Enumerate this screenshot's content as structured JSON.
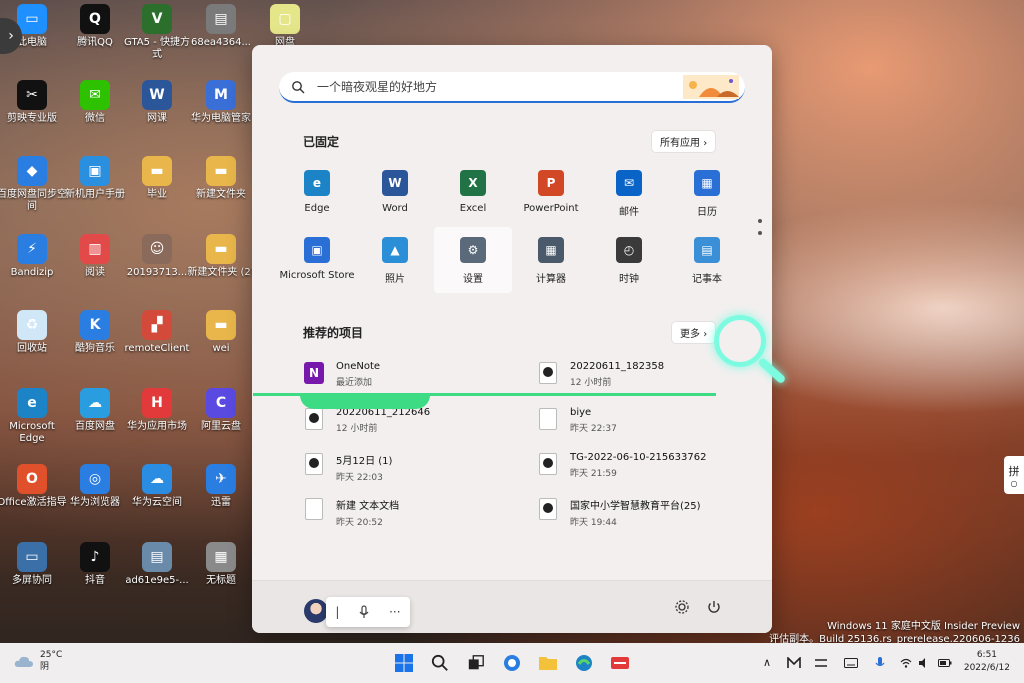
{
  "desktop": {
    "icons": [
      {
        "label": "此电脑",
        "color": "#1e90ff",
        "glyph": "▭"
      },
      {
        "label": "腾讯QQ",
        "color": "#111111",
        "glyph": "Q"
      },
      {
        "label": "GTA5 - 快捷方式",
        "color": "#2c6e2c",
        "glyph": "V"
      },
      {
        "label": "68ea4364...",
        "color": "#7a7a7a",
        "glyph": "▤"
      },
      {
        "label": "网盘",
        "color": "#e5e58a",
        "glyph": "▢"
      },
      {
        "label": "剪映专业版",
        "color": "#111111",
        "glyph": "✂"
      },
      {
        "label": "微信",
        "color": "#2dc100",
        "glyph": "✉"
      },
      {
        "label": "网课",
        "color": "#2b579a",
        "glyph": "W"
      },
      {
        "label": "华为电脑管家",
        "color": "#3a6fd8",
        "glyph": "M"
      },
      {
        "label": "百度网盘同步空间",
        "color": "#2a7de1",
        "glyph": "◆"
      },
      {
        "label": "新机用户手册",
        "color": "#2b8fe0",
        "glyph": "▣"
      },
      {
        "label": "毕业",
        "color": "#e8b64a",
        "glyph": "▬"
      },
      {
        "label": "新建文件夹",
        "color": "#e8b64a",
        "glyph": "▬"
      },
      {
        "label": "Bandizip",
        "color": "#2a7de1",
        "glyph": "⚡"
      },
      {
        "label": "阅读",
        "color": "#e24a4a",
        "glyph": "▥"
      },
      {
        "label": "20193713...",
        "color": "#8a6a5a",
        "glyph": "☺"
      },
      {
        "label": "新建文件夹 (2)",
        "color": "#e8b64a",
        "glyph": "▬"
      },
      {
        "label": "回收站",
        "color": "#cfe7f6",
        "glyph": "♻"
      },
      {
        "label": "酷狗音乐",
        "color": "#2a7de1",
        "glyph": "K"
      },
      {
        "label": "remoteClient",
        "color": "#d44a3a",
        "glyph": "▞"
      },
      {
        "label": "wei",
        "color": "#e8b64a",
        "glyph": "▬"
      },
      {
        "label": "Microsoft Edge",
        "color": "#1c84c6",
        "glyph": "e"
      },
      {
        "label": "百度网盘",
        "color": "#2a9de1",
        "glyph": "☁"
      },
      {
        "label": "华为应用市场",
        "color": "#e23a3a",
        "glyph": "H"
      },
      {
        "label": "阿里云盘",
        "color": "#5a4ae2",
        "glyph": "C"
      },
      {
        "label": "Office激活指导",
        "color": "#e0502a",
        "glyph": "O"
      },
      {
        "label": "华为浏览器",
        "color": "#2a7de1",
        "glyph": "◎"
      },
      {
        "label": "华为云空间",
        "color": "#2a8de1",
        "glyph": "☁"
      },
      {
        "label": "迅雷",
        "color": "#2a7de1",
        "glyph": "✈"
      },
      {
        "label": "多屏协同",
        "color": "#3a6fa8",
        "glyph": "▭"
      },
      {
        "label": "抖音",
        "color": "#111111",
        "glyph": "♪"
      },
      {
        "label": "ad61e9e5-...",
        "color": "#6a8aaa",
        "glyph": "▤"
      },
      {
        "label": "无标题",
        "color": "#8a8a8a",
        "glyph": "▦"
      }
    ]
  },
  "start_menu": {
    "search_placeholder": "一个暗夜观星的好地方",
    "pinned_title": "已固定",
    "all_apps_label": "所有应用",
    "pinned_apps": [
      {
        "label": "Edge",
        "color": "#1c84c6",
        "glyph": "e"
      },
      {
        "label": "Word",
        "color": "#2b579a",
        "glyph": "W"
      },
      {
        "label": "Excel",
        "color": "#217346",
        "glyph": "X"
      },
      {
        "label": "PowerPoint",
        "color": "#d24726",
        "glyph": "P"
      },
      {
        "label": "邮件",
        "color": "#0a64c8",
        "glyph": "✉"
      },
      {
        "label": "日历",
        "color": "#2a6fd6",
        "glyph": "▦"
      },
      {
        "label": "Microsoft Store",
        "color": "#2a6fd6",
        "glyph": "▣"
      },
      {
        "label": "照片",
        "color": "#2a8fd6",
        "glyph": "▲"
      },
      {
        "label": "设置",
        "color": "#5a6a7a",
        "glyph": "⚙"
      },
      {
        "label": "计算器",
        "color": "#4a5a6a",
        "glyph": "▦"
      },
      {
        "label": "时钟",
        "color": "#3a3a3a",
        "glyph": "◴"
      },
      {
        "label": "记事本",
        "color": "#3a8fd6",
        "glyph": "▤"
      }
    ],
    "recommended_title": "推荐的项目",
    "more_label": "更多",
    "recommended": [
      {
        "name": "OneNote",
        "sub": "最近添加",
        "type": "onenote"
      },
      {
        "name": "20220611_182358",
        "sub": "12 小时前",
        "type": "video"
      },
      {
        "name": "20220611_212646",
        "sub": "12 小时前",
        "type": "video"
      },
      {
        "name": "biye",
        "sub": "昨天 22:37",
        "type": "doc"
      },
      {
        "name": "5月12日 (1)",
        "sub": "昨天 22:03",
        "type": "video"
      },
      {
        "name": "TG-2022-06-10-215633762",
        "sub": "昨天 21:59",
        "type": "video"
      },
      {
        "name": "新建 文本文档",
        "sub": "昨天 20:52",
        "type": "doc"
      },
      {
        "name": "国家中小学智慧教育平台(25)",
        "sub": "昨天 19:44",
        "type": "video"
      }
    ],
    "ime_cursor": "|",
    "ime_more": "···"
  },
  "right_tab": {
    "text1": "拼",
    "text2": "○"
  },
  "watermark": {
    "line1": "Windows 11 家庭中文版 Insider Preview",
    "line2": "评估副本。Build 25136.rs_prerelease.220606-1236"
  },
  "taskbar": {
    "temp": "25°C",
    "weather": "阴",
    "time": "6:51",
    "date": "2022/6/12",
    "tray_chevron": "∧"
  }
}
